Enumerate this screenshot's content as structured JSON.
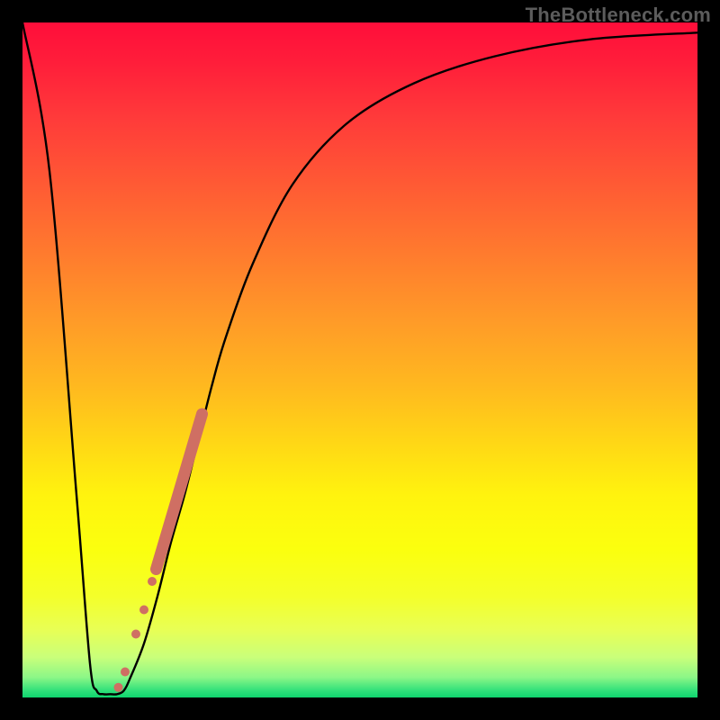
{
  "watermark": "TheBottleneck.com",
  "chart_data": {
    "type": "line",
    "title": "",
    "xlabel": "",
    "ylabel": "",
    "xlim": [
      0,
      100
    ],
    "ylim": [
      0,
      100
    ],
    "series": [
      {
        "name": "bottleneck-curve",
        "x": [
          0,
          4,
          8,
          10,
          11,
          12,
          13,
          14,
          15,
          16,
          18,
          20,
          22,
          24,
          26,
          28,
          30,
          34,
          40,
          48,
          58,
          70,
          84,
          100
        ],
        "y": [
          100,
          78,
          30,
          5,
          1,
          0.5,
          0.5,
          0.5,
          1,
          3,
          8,
          15,
          23,
          30,
          38,
          46,
          53,
          64,
          76,
          85,
          91,
          95,
          97.5,
          98.5
        ]
      }
    ],
    "markers": {
      "name": "highlight-band",
      "color": "#cf6f63",
      "points": [
        {
          "x": 14.2,
          "y": 1.5,
          "r": 5
        },
        {
          "x": 15.2,
          "y": 3.8,
          "r": 5
        },
        {
          "x": 16.8,
          "y": 9.4,
          "r": 5
        },
        {
          "x": 18.0,
          "y": 13.0,
          "r": 5
        },
        {
          "x": 19.2,
          "y": 17.2,
          "r": 5
        }
      ],
      "thick_segment": {
        "x0": 19.8,
        "y0": 19.0,
        "x1": 26.6,
        "y1": 42.0
      }
    }
  }
}
